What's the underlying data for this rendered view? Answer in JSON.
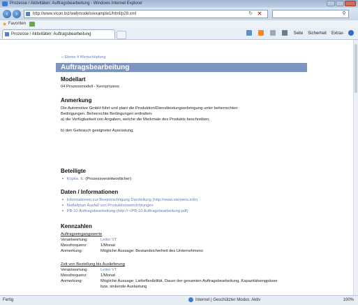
{
  "browser": {
    "window_title": "Prozesse / Aktivitäten: Auftragsbearbeitung - Windows Internet Explorer",
    "address_url": "http://www.vicon.biz/webmodels/example1/html/p28.xml",
    "favorites_label": "Favoriten",
    "tab_title": "Prozesse / Aktivitäten: Auftragsbearbeitung",
    "command_bar": [
      "Seite",
      "Sicherheit",
      "Extras"
    ],
    "status_left": "Fertig",
    "status_zone": "Internet | Geschützter Modus: Aktiv",
    "zoom": "100%"
  },
  "page": {
    "breadcrumb": "« Ebene 4 Wertschöpfung",
    "title": "Auftragsbearbeitung",
    "modellart_heading": "Modellart",
    "modellart_value": "04 Prozessmodell - Kernprozess",
    "anmerkung_heading": "Anmerkung",
    "anmerkung_lines": [
      "Die Automotive GmbH führt und plant die Produktion/Dienstleistungserbringung unter beherrschten",
      "Bedingungen. Beherrschte Bedingungen enthalten:",
      "a) die Verfügbarkeit von Angaben, welche die Merkmale des Produkts beschreiben,",
      "b) den Gebrauch geeigneter Ausrüstung,"
    ],
    "beteiligte_heading": "Beteiligte",
    "beteiligte": [
      {
        "name": "Köpke, E.",
        "role": "(Prozessverantwortlicher)"
      }
    ],
    "daten_heading": "Daten / Informationen",
    "daten_items": [
      {
        "text": "Informationen zur Beeinträchtigung Darstellung",
        "link": "(http://www.siemens.info)"
      },
      {
        "text": "Notfallplan Ausfall von Produktionseinrichtungen",
        "link": ""
      },
      {
        "text": "PB-10 Auftragsbearbeitung",
        "link": "(http://~/PB-10 Auftragsbearbeitung.pdf)"
      }
    ],
    "kennzahlen_heading": "Kennzahlen",
    "kennzahlen": [
      {
        "title": "Auftragseingangswerte",
        "rows": [
          {
            "key": "Verantwortung:",
            "value": "Leiter VT"
          },
          {
            "key": "Messfrequenz:",
            "value": "1/Monat"
          },
          {
            "key": "Anmerkung:",
            "value": "Mögliche Aussage: Bestandsicherheit des Unternehmens"
          }
        ]
      },
      {
        "title": "Zeit von Bestellung bis Auslieferung",
        "rows": [
          {
            "key": "Verantwortung:",
            "value": "Leiter VT"
          },
          {
            "key": "Messfrequenz:",
            "value": "1/Monat"
          },
          {
            "key": "Anmerkung:",
            "value": "Mögliche Aussage: Lieferflexibilität, Dauer der gesamten Auftragsbearbeitung, Kapazitätsengpässe"
          },
          {
            "key": "",
            "value": "bzw. sinkende Auslastung"
          }
        ]
      }
    ]
  },
  "colors": {
    "title_bar": "#7d93c0",
    "link": "#6a7fb0"
  }
}
